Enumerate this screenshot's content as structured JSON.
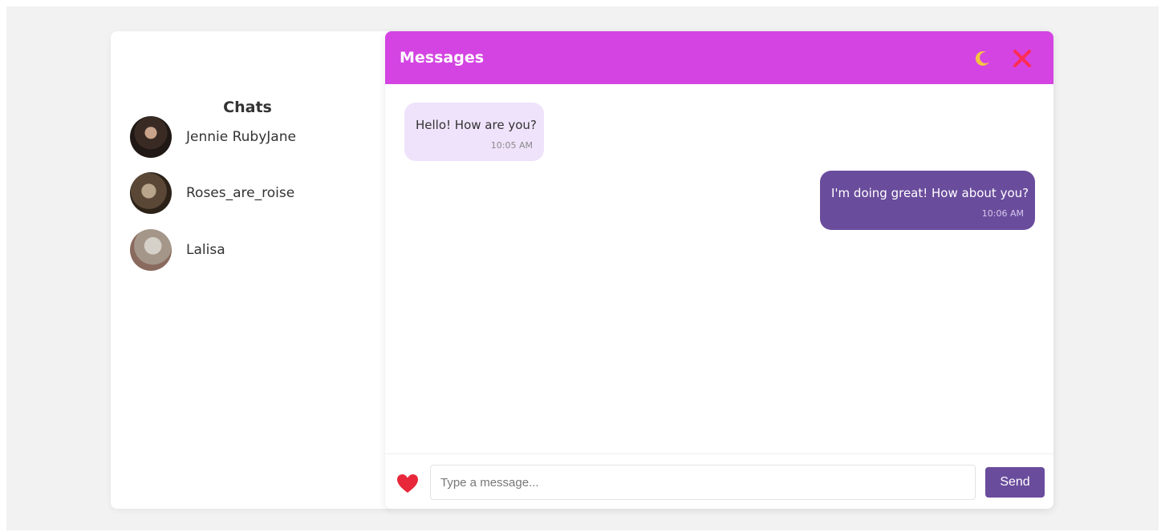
{
  "sidebar": {
    "title": "Chats",
    "contacts": [
      {
        "name": "Jennie RubyJane",
        "avatar": "avatar-photo"
      },
      {
        "name": "Roses_are_roise",
        "avatar": "avatar-photo"
      },
      {
        "name": "Lalisa",
        "avatar": "avatar-photo"
      }
    ]
  },
  "header": {
    "title": "Messages",
    "theme_icon": "moon-icon",
    "close_icon": "close-icon",
    "background_color": "#d444e3",
    "close_icon_color": "#ff2d55",
    "moon_icon_color": "#f5c542"
  },
  "messages": [
    {
      "direction": "incoming",
      "text": "Hello! How are you?",
      "time": "10:05 AM"
    },
    {
      "direction": "outgoing",
      "text": "I'm doing great! How about you?",
      "time": "10:06 AM"
    }
  ],
  "composer": {
    "heart_icon": "heart-icon",
    "input_placeholder": "Type a message...",
    "input_value": "",
    "send_label": "Send",
    "accent_color": "#6a4c9c"
  }
}
